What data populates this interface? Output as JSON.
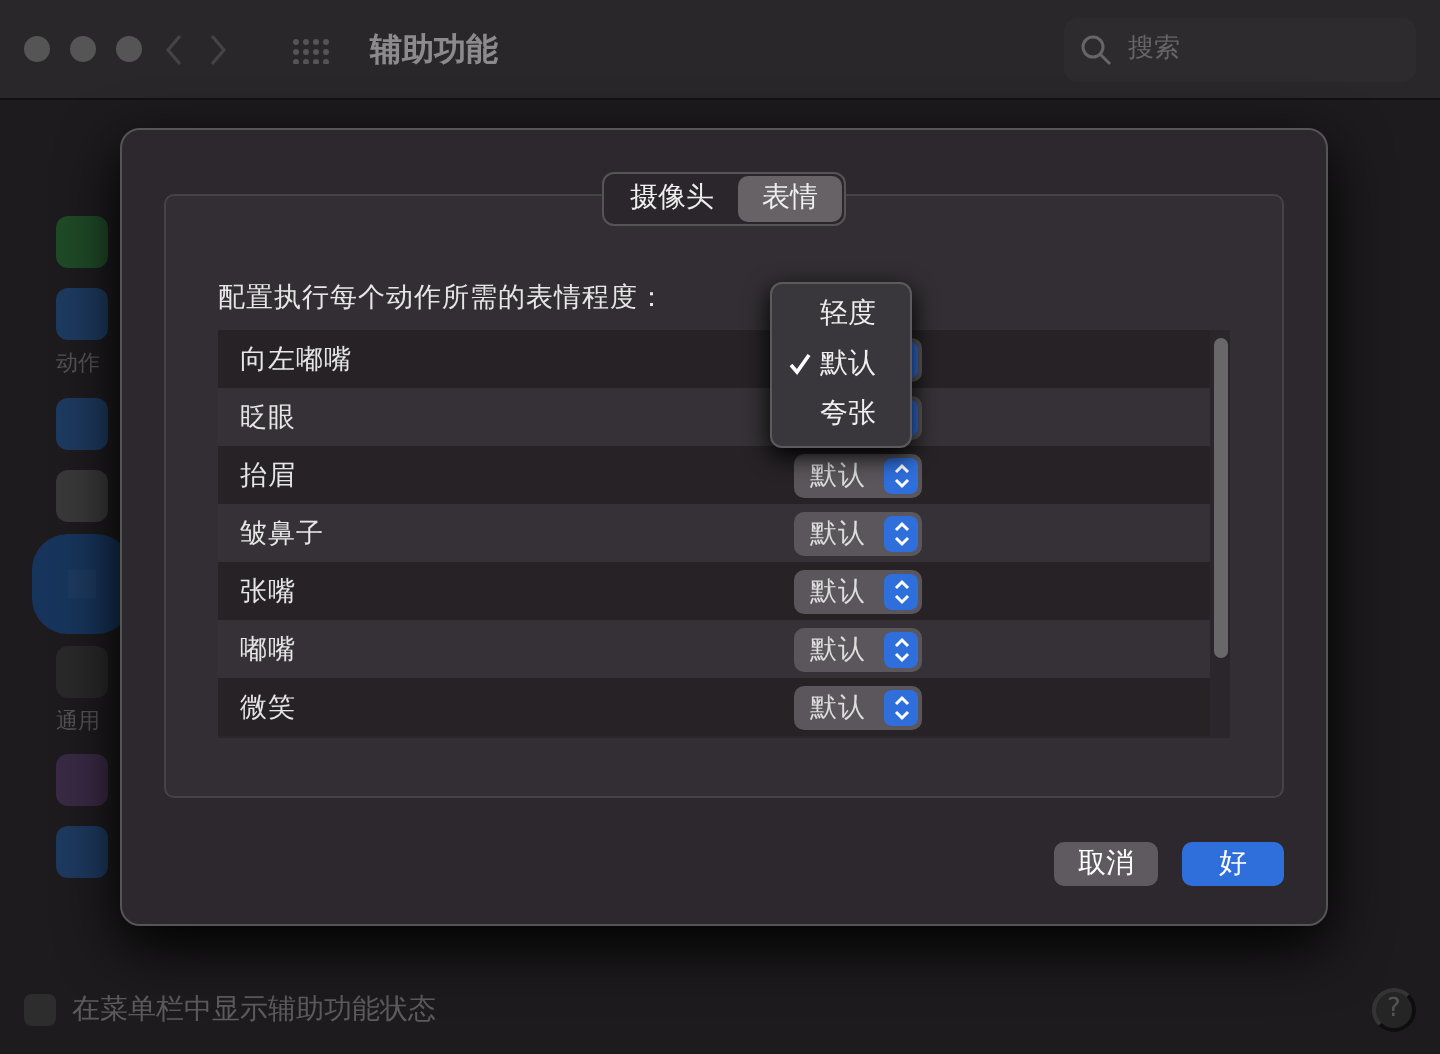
{
  "window": {
    "title": "辅助功能",
    "search": {
      "placeholder": "搜索"
    }
  },
  "sidebar": {
    "items": [
      {
        "kind": "icon",
        "color": "#1f4a27",
        "selected": false
      },
      {
        "kind": "icon",
        "color": "#1d3a60",
        "selected": false
      },
      {
        "kind": "label",
        "label": "动作"
      },
      {
        "kind": "icon",
        "color": "#1d3a60",
        "selected": false
      },
      {
        "kind": "icon",
        "color": "#3a393a",
        "selected": false
      },
      {
        "kind": "icon",
        "color": "#1d3a60",
        "selected": true
      },
      {
        "kind": "icon",
        "color": "#2a292a",
        "selected": false
      },
      {
        "kind": "label",
        "label": "通用"
      },
      {
        "kind": "icon",
        "color": "#3a2a45",
        "selected": false
      },
      {
        "kind": "icon",
        "color": "#1d3a60",
        "selected": false
      }
    ]
  },
  "footer": {
    "checkbox": {
      "label": "在菜单栏中显示辅助功能状态",
      "checked": false
    },
    "help": "?"
  },
  "dialog": {
    "tabs": [
      {
        "label": "摄像头",
        "selected": false
      },
      {
        "label": "表情",
        "selected": true
      }
    ],
    "instruction": "配置执行每个动作所需的表情程度：",
    "rows": [
      {
        "name": "向左嘟嘴"
      },
      {
        "name": "眨眼"
      },
      {
        "name": "抬眉",
        "value": "默认"
      },
      {
        "name": "皱鼻子",
        "value": "默认"
      },
      {
        "name": "张嘴",
        "value": "默认"
      },
      {
        "name": "嘟嘴",
        "value": "默认"
      },
      {
        "name": "微笑",
        "value": "默认"
      }
    ],
    "menu": {
      "options": [
        {
          "label": "轻度",
          "selected": false
        },
        {
          "label": "默认",
          "selected": true
        },
        {
          "label": "夸张",
          "selected": false
        }
      ]
    },
    "buttons": [
      {
        "label": "取消",
        "kind": "cancel"
      },
      {
        "label": "好",
        "kind": "default"
      }
    ]
  }
}
